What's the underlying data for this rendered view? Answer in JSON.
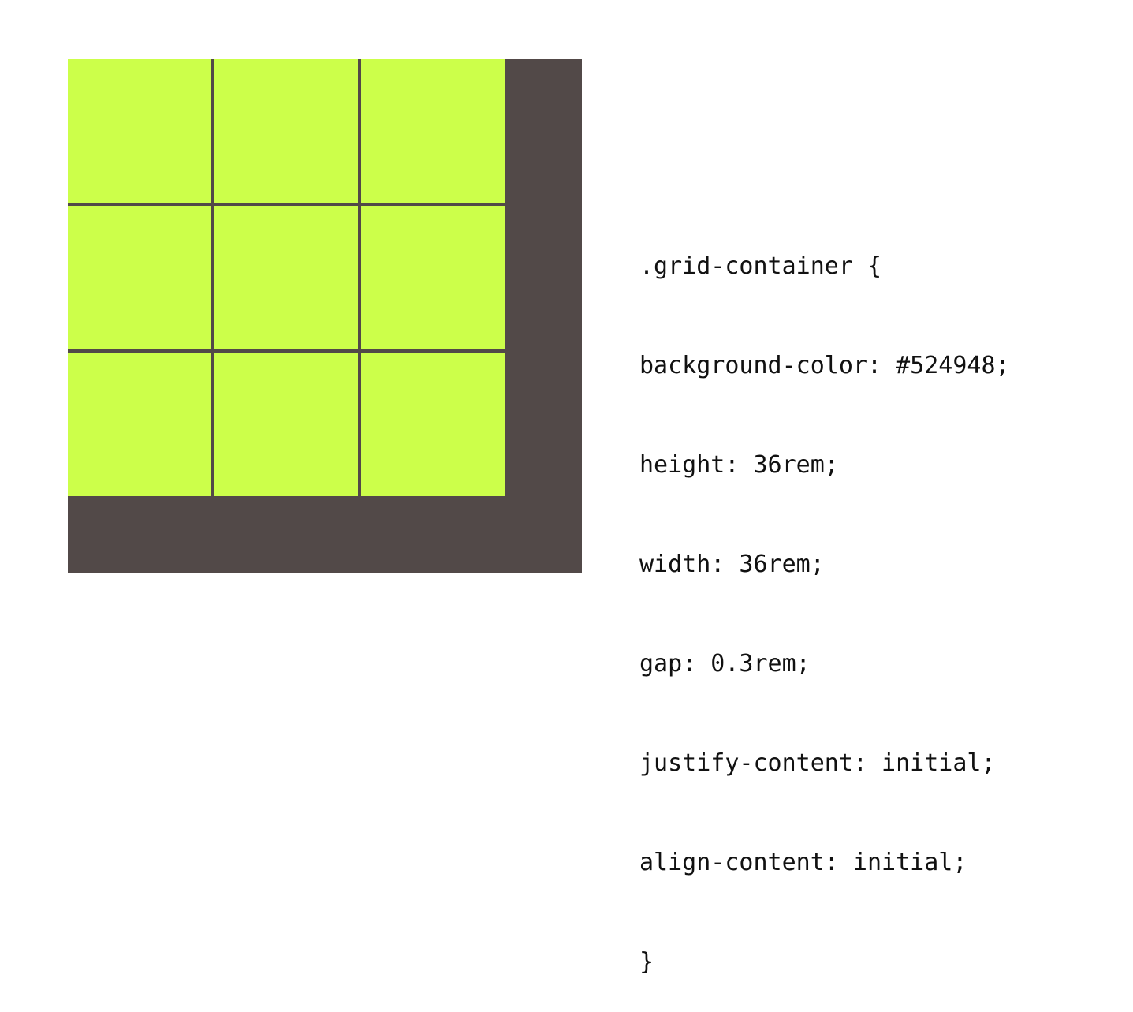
{
  "grid": {
    "background_color": "#524948",
    "item_color": "#ccff4a",
    "rows": 3,
    "columns": 3,
    "item_count": 9
  },
  "code": {
    "lines": [
      ".grid-container {",
      "background-color: #524948;",
      "height: 36rem;",
      "width: 36rem;",
      "gap: 0.3rem;",
      "justify-content: initial;",
      "align-content: initial;",
      "}"
    ]
  }
}
